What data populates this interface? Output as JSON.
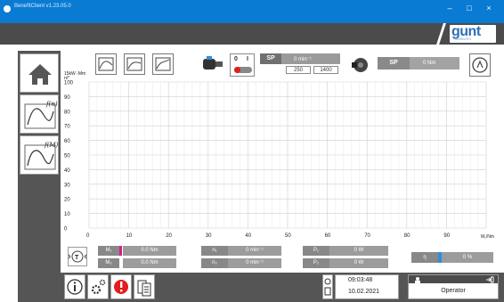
{
  "window": {
    "title": "BenefitClient v1.23.05.0",
    "controls": [
      "–",
      "□",
      "×"
    ]
  },
  "brand": {
    "logo": "gunt",
    "logo_sub": "HAMBURG"
  },
  "sidebar": {
    "home_icon": "home-icon",
    "items": [
      {
        "name": "speed-curve",
        "label": "f(n)"
      },
      {
        "name": "torque-curve",
        "label": "f(M)"
      }
    ]
  },
  "toolbar": {
    "left_buttons": [
      "chart-mode-1-icon",
      "chart-mode-2-icon",
      "chart-mode-3-icon"
    ],
    "motor": {
      "switch_labels": [
        "0",
        "I"
      ],
      "sp_label": "SP",
      "sp_value": "0 min⁻¹",
      "preset_1": "250",
      "preset_2": "1400"
    },
    "brake": {
      "sp_label": "SP",
      "sp_value": "0 Nm"
    },
    "reset_icon": "reset-icon"
  },
  "chart_data": {
    "type": "line",
    "ylabel": "15kW -Mm\nn/°",
    "xlabel": "M₁/Nm",
    "x_ticks": [
      0,
      10,
      20,
      30,
      40,
      50,
      60,
      70,
      80,
      90
    ],
    "y_ticks": [
      0,
      10,
      20,
      30,
      40,
      50,
      60,
      70,
      80,
      90,
      100
    ],
    "xlim": [
      0,
      100
    ],
    "ylim": [
      0,
      100
    ],
    "grid": true,
    "series": []
  },
  "readouts": {
    "tacho_icon": "tachometer-icon",
    "rows": [
      [
        {
          "label": "M₁",
          "value": "0.0 Nm"
        },
        {
          "label": "n₁",
          "value": "0 min⁻¹"
        },
        {
          "label": "P₁",
          "value": "0 W"
        }
      ],
      [
        {
          "label": "M₂",
          "value": "0.0 Nm"
        },
        {
          "label": "n₂",
          "value": "0 min⁻¹"
        },
        {
          "label": "P₂",
          "value": "0 W"
        }
      ]
    ],
    "efficiency": {
      "label": "η",
      "value": "0 %"
    }
  },
  "footer": {
    "buttons": [
      "info-icon",
      "settings-icon",
      "alarm-icon",
      "data-export-icon"
    ],
    "time": "09:03:48",
    "date": "10.02.2021",
    "user": "Operator"
  },
  "colors": {
    "titlebar": "#0a7bd3",
    "dark_gray": "#4b4b4b",
    "alarm_red": "#e31d1d",
    "accent_magenta": "#d0208a",
    "accent_blue": "#2f8de0"
  }
}
